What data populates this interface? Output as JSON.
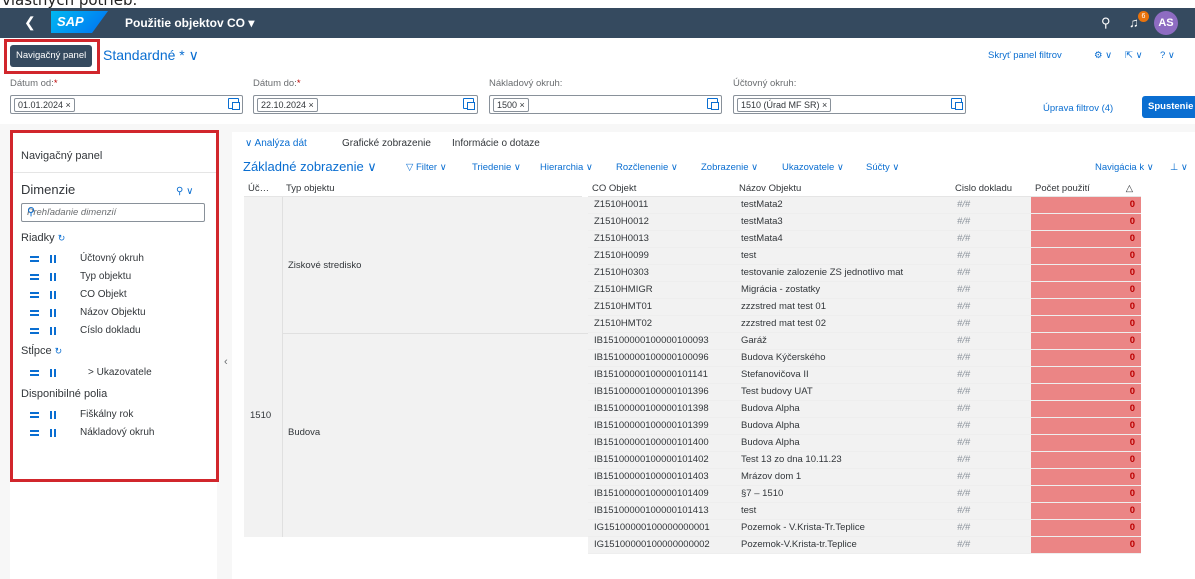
{
  "page_header_fragment": "vlastných potrieb.",
  "shell": {
    "back_icon": "back-icon",
    "logo": "SAP",
    "app_title": "Použitie objektov CO ▾",
    "notification_count": "6",
    "avatar_initials": "AS"
  },
  "header": {
    "nav_panel_button": "Navigačný panel",
    "variant": "Standardné * ∨",
    "hide_filter": "Skryť panel filtrov",
    "settings_menu": "⚙ ∨",
    "share_menu": "⇱ ∨",
    "help_menu": "? ∨"
  },
  "filters": {
    "date_from": {
      "label": "Dátum od:",
      "required": "*",
      "value": "01.01.2024 ×"
    },
    "date_to": {
      "label": "Dátum do:",
      "required": "*",
      "value": "22.10.2024 ×"
    },
    "cost_area": {
      "label": "Nákladový okruh:",
      "value": "1500 ×"
    },
    "accounting_area": {
      "label": "Účtovný okruh:",
      "value": "1510 (Úrad MF SR) ×"
    },
    "adapt_filters": "Úprava filtrov (4)",
    "go": "Spustenie"
  },
  "left_panel": {
    "title": "Navigačný panel",
    "dimensions": "Dimenzie",
    "search_placeholder": "Prehľadanie dimenzií",
    "rows_label": "Riadky",
    "rows": [
      "Účtovný okruh",
      "Typ objektu",
      "CO Objekt",
      "Názov Objektu",
      "Císlo dokladu"
    ],
    "columns_label": "Stĺpce",
    "columns": [
      "> Ukazovatele"
    ],
    "available_label": "Disponibilné polia",
    "available": [
      "Fiškálny rok",
      "Nákladový okruh"
    ]
  },
  "tabs": [
    "∨ Analýza dát",
    "Grafické zobrazenie",
    "Informácie o dotaze"
  ],
  "toolbar": {
    "main": "Základné zobrazenie ∨",
    "items": [
      "▽ Filter ∨",
      "Triedenie ∨",
      "Hierarchia ∨",
      "Rozčlenenie ∨",
      "Zobrazenie ∨",
      "Ukazovatele ∨",
      "Súčty ∨"
    ],
    "right": "Navigácia k ∨",
    "right2": "⊥ ∨"
  },
  "grid": {
    "headers": [
      "Úč…",
      "Typ objektu",
      "CO Objekt",
      "Názov Objektu",
      "Cislo dokladu",
      "Počet použití"
    ],
    "sort_icon": "△",
    "account": "1510",
    "group1": "Ziskové stredisko",
    "group2": "Budova",
    "rows": [
      [
        "Z1510H0011",
        "testMata2",
        "#/#",
        "0"
      ],
      [
        "Z1510H0012",
        "testMata3",
        "#/#",
        "0"
      ],
      [
        "Z1510H0013",
        "testMata4",
        "#/#",
        "0"
      ],
      [
        "Z1510H0099",
        "test",
        "#/#",
        "0"
      ],
      [
        "Z1510H0303",
        "testovanie zalozenie ZS jednotlivo mat",
        "#/#",
        "0"
      ],
      [
        "Z1510HMIGR",
        "Migrácia - zostatky",
        "#/#",
        "0"
      ],
      [
        "Z1510HMT01",
        "zzzstred mat test 01",
        "#/#",
        "0"
      ],
      [
        "Z1510HMT02",
        "zzzstred mat test 02",
        "#/#",
        "0"
      ],
      [
        "IB15100000100000100093",
        "Garáž",
        "#/#",
        "0"
      ],
      [
        "IB15100000100000100096",
        "Budova Kýčerského",
        "#/#",
        "0"
      ],
      [
        "IB15100000100000101141",
        "Stefanovičova II",
        "#/#",
        "0"
      ],
      [
        "IB15100000100000101396",
        "Test budovy UAT",
        "#/#",
        "0"
      ],
      [
        "IB15100000100000101398",
        "Budova Alpha",
        "#/#",
        "0"
      ],
      [
        "IB15100000100000101399",
        "Budova Alpha",
        "#/#",
        "0"
      ],
      [
        "IB15100000100000101400",
        "Budova Alpha",
        "#/#",
        "0"
      ],
      [
        "IB15100000100000101402",
        "Test 13 zo dna 10.11.23",
        "#/#",
        "0"
      ],
      [
        "IB15100000100000101403",
        "Mrázov dom 1",
        "#/#",
        "0"
      ],
      [
        "IB15100000100000101409",
        "§7 – 1510",
        "#/#",
        "0"
      ],
      [
        "IB15100000100000101413",
        "test",
        "#/#",
        "0"
      ],
      [
        "IG15100000100000000001",
        "Pozemok - V.Krista-Tr.Teplice",
        "#/#",
        "0"
      ],
      [
        "IG15100000100000000002",
        "Pozemok-V.Krista-tr.Teplice",
        "#/#",
        "0"
      ]
    ]
  },
  "colors": {
    "shell": "#354a5f",
    "accent": "#0a6ed1",
    "highlight_red": "#d1262c",
    "value_cell": "#eb8585"
  }
}
